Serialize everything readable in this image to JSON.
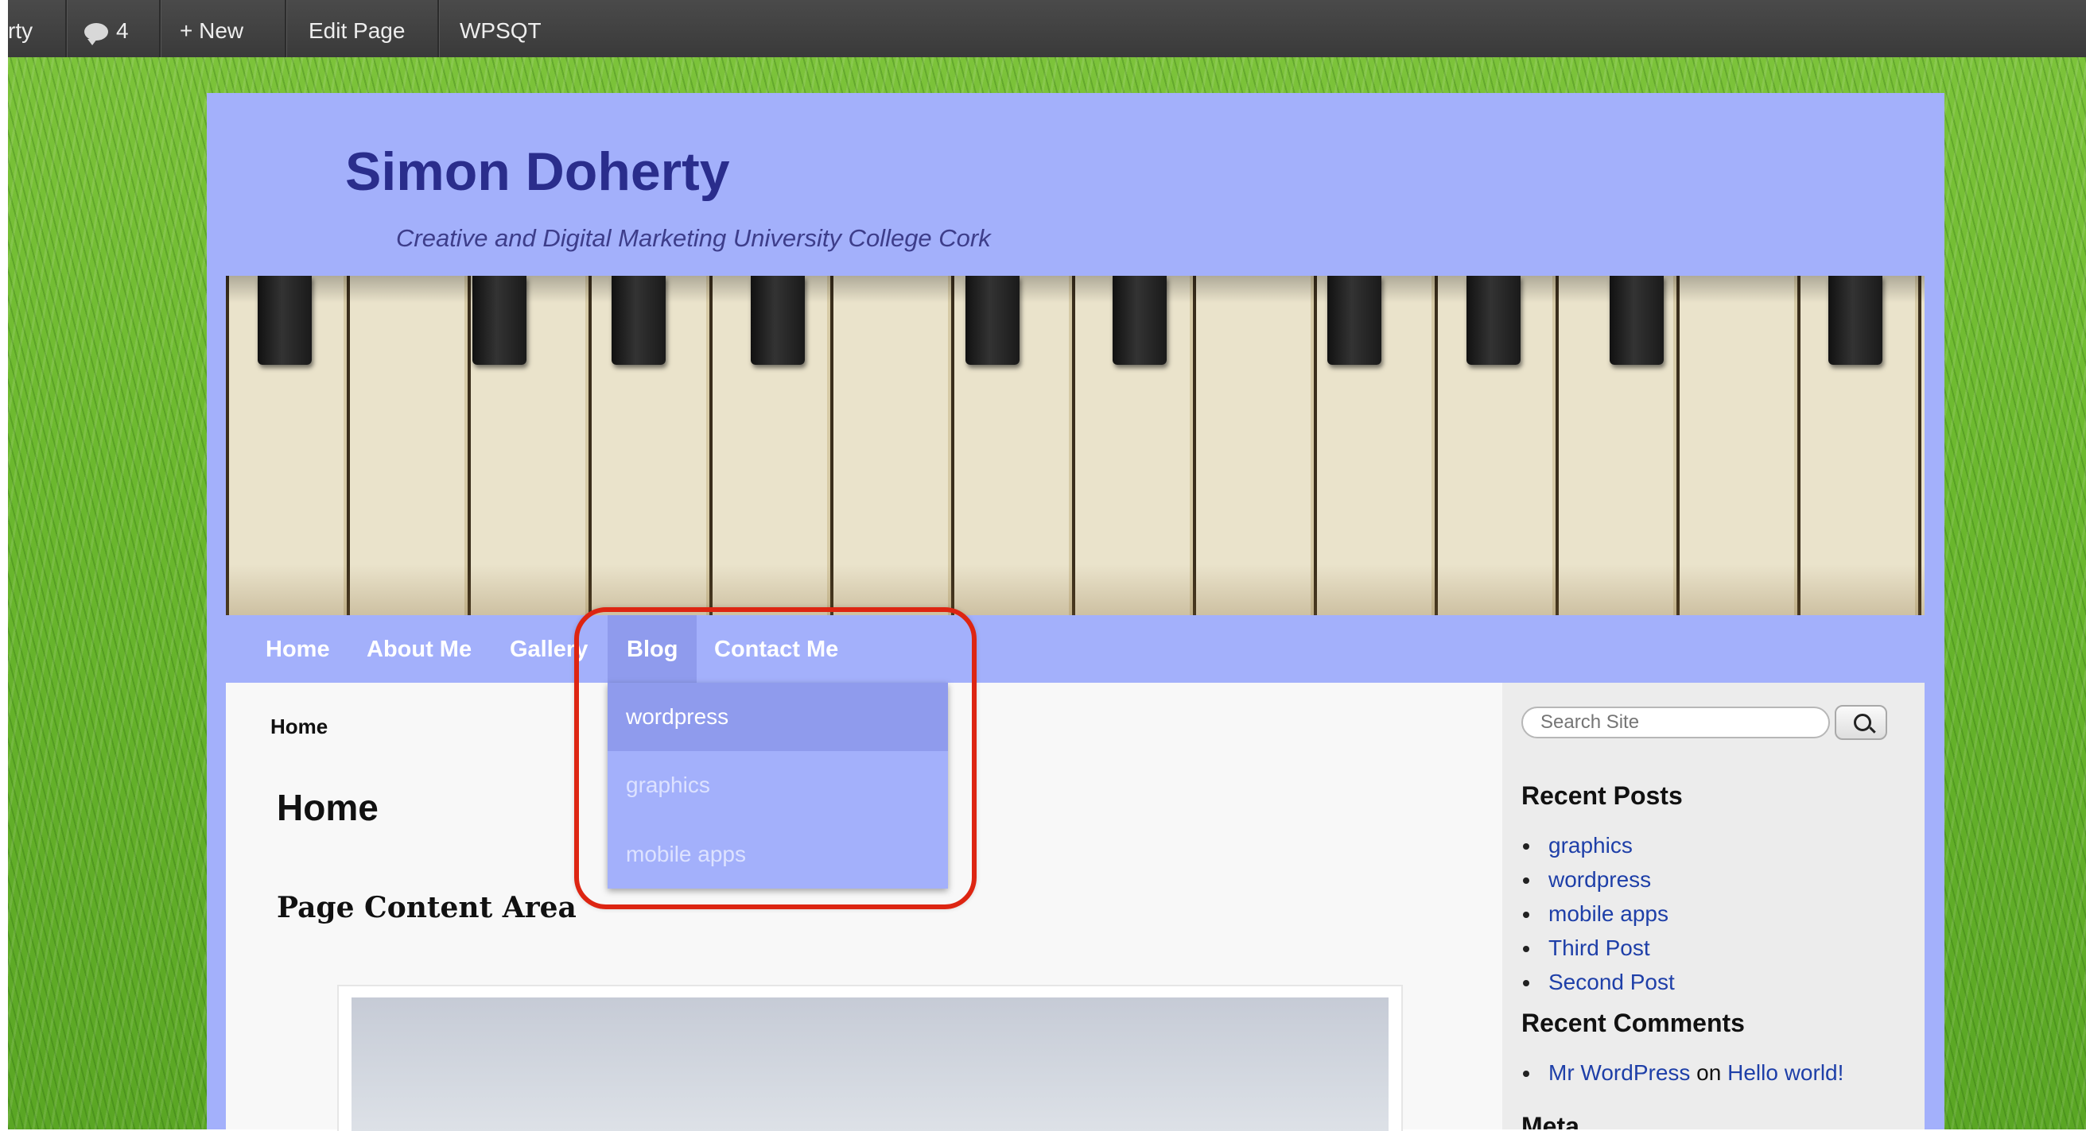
{
  "admin_bar": {
    "site_name_fragment": "rty",
    "comments_count": "4",
    "new_label": "+ New",
    "edit_page_label": "Edit Page",
    "plugin_label": "WPSQT"
  },
  "site": {
    "title": "Simon Doherty",
    "description": "Creative and Digital Marketing University College Cork"
  },
  "nav": {
    "items": [
      "Home",
      "About Me",
      "Gallery",
      "Blog",
      "Contact Me"
    ],
    "active": "Blog",
    "dropdown": [
      "wordpress",
      "graphics",
      "mobile apps"
    ]
  },
  "content": {
    "breadcrumb": "Home",
    "page_title": "Home",
    "heading": "Page Content Area"
  },
  "sidebar": {
    "search_placeholder": "Search Site",
    "recent_posts_title": "Recent Posts",
    "recent_posts": [
      "graphics",
      "wordpress",
      "mobile apps",
      "Third Post",
      "Second Post"
    ],
    "recent_comments_title": "Recent Comments",
    "recent_comment": {
      "author": "Mr WordPress",
      "on": "on",
      "post": "Hello world!"
    },
    "meta_title": "Meta"
  },
  "colors": {
    "page_bg": "#a3b0fb",
    "nav_active": "#8f9bed",
    "title": "#2a2d8c",
    "link": "#1e3fa8",
    "highlight": "#dd2512"
  },
  "icons": [
    "comment-bubble-icon",
    "search-icon"
  ]
}
